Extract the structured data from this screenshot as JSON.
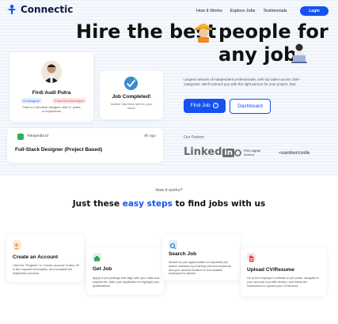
{
  "brand": {
    "name": "Connectic"
  },
  "nav": {
    "links": [
      "How It Works",
      "Explore Jobs",
      "Testimonials"
    ],
    "login_label": "Login"
  },
  "hero": {
    "headline_line1": "Hire the best",
    "headline_line2_a": "people for",
    "headline_line2_b": "any job",
    "description": "Largest network of independent professionals, with top talent across 100+ categories. We'll connect you with the right person for your project, fast.",
    "find_job_label": "Find Job",
    "dashboard_label": "Dashboard",
    "partner_label": "Our Partner",
    "partners": {
      "linkedin_a": "Linked",
      "linkedin_b": "in",
      "pkb_line1": "PKS digital",
      "pkb_line2": "school",
      "sanbercode": "sanbercode"
    }
  },
  "profile_card": {
    "name": "Firdi Audi Putra",
    "tags": [
      "UI Designer",
      "Front End Developer"
    ],
    "description": "Firdi is a full-stack designer with 3+ years of experience"
  },
  "completed_card": {
    "title": "Job Completed!",
    "subtitle": "Invoice has been sent to your inbox"
  },
  "job_card": {
    "company": "Tokopedia.id",
    "time": "8h ago",
    "title": "Full-Stack Designer (Project Based)"
  },
  "how_section": {
    "eyebrow": "How it works?",
    "title_a": "Just these ",
    "title_highlight": "easy steps",
    "title_b": " to find jobs with us"
  },
  "steps": [
    {
      "title": "Create an Account",
      "description": "Click the \"Register\" or \"Create account\" button, fill in the required information, and complete the registration process.",
      "color": "#f4a24c"
    },
    {
      "title": "Get Job",
      "description": "Apply to job postings that align with your skills and experience, tailor your application to highlight your qualifications",
      "color": "#2fa35a"
    },
    {
      "title": "Search Job",
      "description": "Search for job opportunities on reputable job search websites by entering relevant keywords and your desired location to find suitable employment options.",
      "color": "#3b7be0"
    },
    {
      "title": "Upload CV/Resume",
      "description": "Go to the employer's website or job portal, navigate to your account or profile section, and follow the instructions to upload your CV/resume.",
      "color": "#e24b4b"
    }
  ],
  "colors": {
    "accent": "#1652f0",
    "text": "#111111"
  }
}
